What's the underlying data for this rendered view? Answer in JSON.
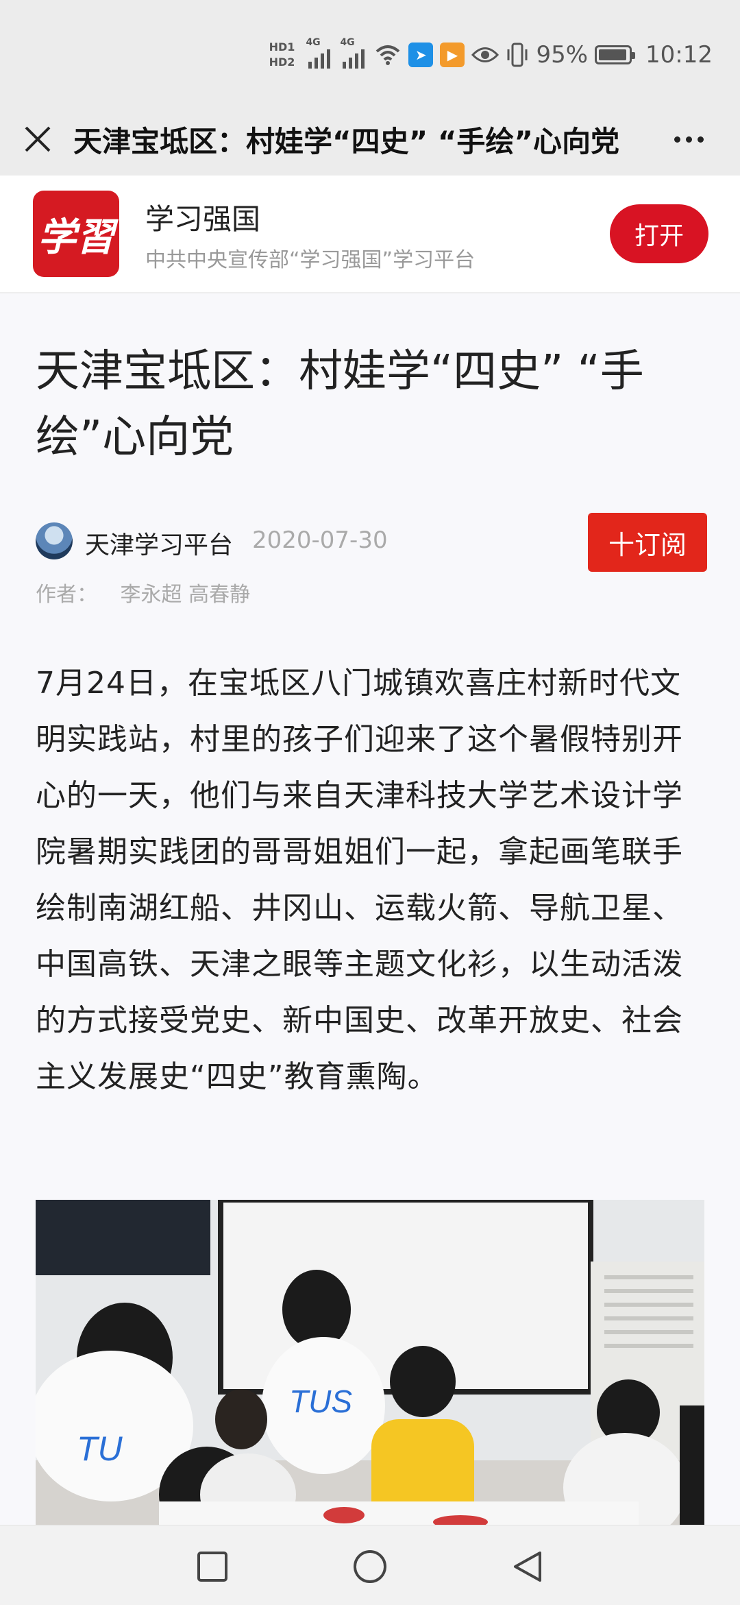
{
  "status_bar": {
    "hd1": "HD1",
    "hd2": "HD2",
    "net1": "4G",
    "net2": "4G",
    "battery_pct": "95%",
    "battery_level": 0.95,
    "time": "10:12",
    "icons": [
      "hd-icon",
      "signal-icon",
      "wifi-icon",
      "app-notification-icon",
      "video-app-icon",
      "eye-icon",
      "vibrate-icon",
      "battery-icon"
    ]
  },
  "title_bar": {
    "title": "天津宝坻区：村娃学“四史” “手绘”心向党"
  },
  "app_banner": {
    "logo_text": "学習",
    "name": "学习强国",
    "description": "中共中央宣传部“学习强国”学习平台",
    "open_label": "打开"
  },
  "article": {
    "title": "天津宝坻区：村娃学“四史” “手绘”心向党",
    "source_name": "天津学习平台",
    "date": "2020-07-30",
    "subscribe_label": "十订阅",
    "author_label": "作者：",
    "authors": "李永超 高春静",
    "body": "7月24日，在宝坻区八门城镇欢喜庄村新时代文明实践站，村里的孩子们迎来了这个暑假特别开心的一天，他们与来自天津科技大学艺术设计学院暑期实践团的哥哥姐姐们一起，拿起画笔联手绘制南湖红船、井冈山、运载火箭、导航卫星、中国高铁、天津之眼等主题文化衫，以生动活泼的方式接受党史、新中国史、改革开放史、社会主义发展史“四史”教育熏陶。"
  },
  "colors": {
    "brand_red": "#d81323",
    "subscribe_red": "#e2261b",
    "bar_gray": "#ececec"
  }
}
